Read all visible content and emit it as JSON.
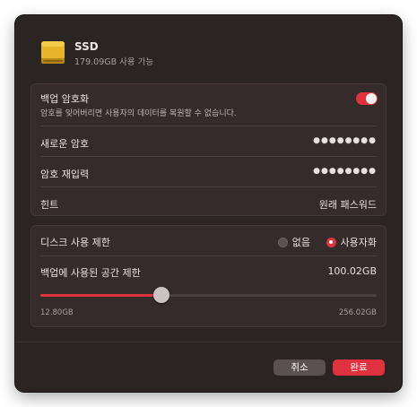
{
  "drive": {
    "name": "SSD",
    "available": "179.09GB 사용 가능",
    "icon": "ssd-drive-icon"
  },
  "encryption": {
    "title": "백업 암호화",
    "description": "암호를 잊어버리면 사용자의 데이터를 복원할 수 없습니다.",
    "enabled": true,
    "new_password_label": "새로운 암호",
    "new_password_value": "●●●●●●●●",
    "confirm_password_label": "암호 재입력",
    "confirm_password_value": "●●●●●●●●",
    "hint_label": "힌트",
    "hint_value": "원래 패스워드"
  },
  "disk_limit": {
    "title": "디스크 사용 제한",
    "option_none": "없음",
    "option_custom": "사용자화",
    "selected": "사용자화",
    "space_label": "백업에 사용된 공간 제한",
    "space_value": "100.02GB",
    "slider_fraction": 0.36,
    "slider_min": "12.80GB",
    "slider_max": "256.02GB"
  },
  "buttons": {
    "cancel": "취소",
    "done": "완료"
  },
  "colors": {
    "accent": "#e0323e",
    "background": "#2a2422"
  }
}
